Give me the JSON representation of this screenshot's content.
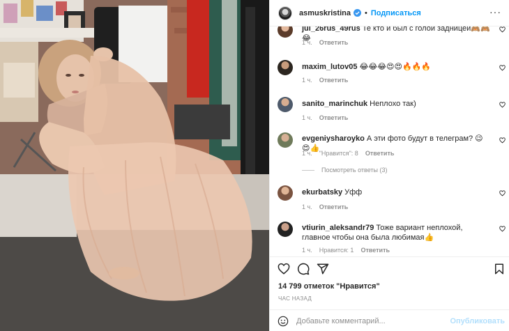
{
  "header": {
    "username": "asmuskristina",
    "separator": "•",
    "follow_label": "Подписаться",
    "more": "···"
  },
  "comments": [
    {
      "user": "jul_26rus_49rus",
      "text": "Те кто и был с голой задницей🙈🙈😂",
      "time": "1 ч.",
      "likes": "",
      "reply": "Ответить"
    },
    {
      "user": "maxim_lutov05",
      "text": "😂😂😂😍😍🔥🔥🔥",
      "time": "1 ч.",
      "likes": "",
      "reply": "Ответить"
    },
    {
      "user": "sanito_marinchuk",
      "text": "Неплохо так)",
      "time": "1 ч.",
      "likes": "",
      "reply": "Ответить"
    },
    {
      "user": "evgeniysharoyko",
      "text": "А эти фото будут в телеграм? 😉😍👍",
      "time": "1 ч.",
      "likes": "\"Нравится\": 8",
      "reply": "Ответить"
    },
    {
      "user": "ekurbatsky",
      "text": "Уфф",
      "time": "1 ч.",
      "likes": "",
      "reply": "Ответить"
    },
    {
      "user": "vtiurin_aleksandr79",
      "text": "Тоже вариант неплохой, главное чтобы она была любимая👍",
      "time": "1 ч.",
      "likes": "Нравится: 1",
      "reply": "Ответить"
    }
  ],
  "view_replies": "Посмотреть ответы (3)",
  "likes_text": "14 799 отметок \"Нравится\"",
  "time_ago": "ЧАС НАЗАД",
  "add_comment": {
    "placeholder": "Добавьте комментарий...",
    "publish_label": "Опубликовать"
  },
  "colors": {
    "accent": "#0095f6",
    "muted": "#8e8e8e",
    "publish_disabled": "#b2dffc"
  },
  "icons": [
    "heart-icon",
    "comment-icon",
    "share-icon",
    "bookmark-icon",
    "emoji-icon",
    "verified-icon",
    "more-icon"
  ]
}
